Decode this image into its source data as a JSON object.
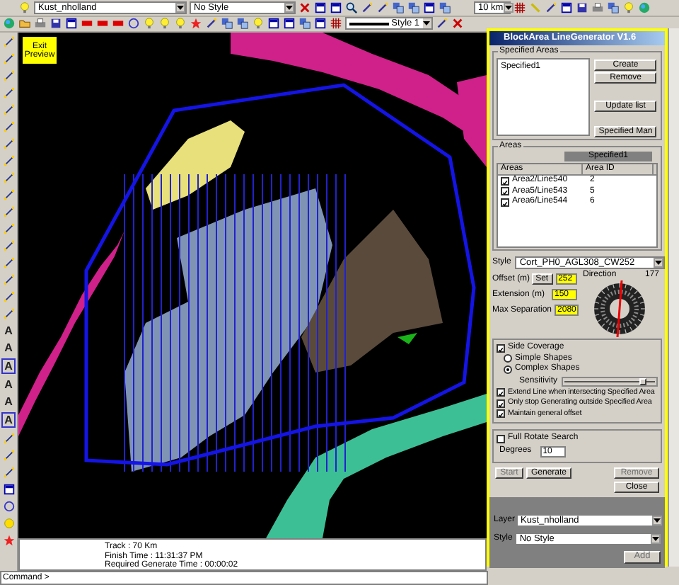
{
  "toolbar": {
    "layer_select": "Kust_nholland",
    "style_select": "No Style",
    "scale_select": "10 km",
    "line_style_select": "Style 1"
  },
  "tool_palette": {
    "text_tools": [
      "A",
      "A",
      "A",
      "A",
      "A",
      "A"
    ]
  },
  "map": {
    "exit_preview_button": "Exit Preview"
  },
  "output": {
    "lines": [
      "Track : 70 Km",
      "Finish Time : 11:31:37 PM",
      "Required Generate Time : 00:00:02"
    ],
    "command_prompt": "Command >"
  },
  "panel": {
    "title": "BlockArea LineGenerator V1.6",
    "specified_areas": {
      "label": "Specified Areas",
      "items": [
        {
          "label": "Specified1",
          "selected": false
        }
      ],
      "buttons": [
        "Create",
        "Remove",
        "Update list",
        "Specified Man"
      ]
    },
    "areas": {
      "label": "Areas",
      "set_name": "Specified1",
      "columns": [
        "Areas",
        "Area ID"
      ],
      "rows": [
        {
          "name": "Area2/Line540",
          "id": "2",
          "checked": true
        },
        {
          "name": "Area5/Line543",
          "id": "5",
          "checked": true
        },
        {
          "name": "Area6/Line544",
          "id": "6",
          "checked": true
        }
      ]
    },
    "style": {
      "label": "Style",
      "value": "Cort_PH0_AGL308_CW252"
    },
    "fields": [
      {
        "label": "Offset (m)",
        "button": "Set",
        "value": "252"
      },
      {
        "label": "Extension (m)",
        "value": "150"
      },
      {
        "label": "Max Separation",
        "value": "2080"
      }
    ],
    "direction": {
      "label": "Direction",
      "value": "177"
    },
    "side_coverage": {
      "label": "Side Coverage",
      "checked": true,
      "options": [
        {
          "label": "Simple Shapes",
          "selected": false
        },
        {
          "label": "Complex Shapes",
          "selected": true
        }
      ],
      "sensitivity": {
        "label": "Sensitivity",
        "level": 0.9
      }
    },
    "options": [
      {
        "label": "Extend Line when intersecting Specified Area",
        "checked": true
      },
      {
        "label": "Only stop Generating outside Specified Area",
        "checked": true
      },
      {
        "label": "Maintain general offset",
        "checked": true
      }
    ],
    "full_rotate": {
      "label": "Full Rotate Search",
      "checked": false,
      "degrees_label": "Degrees",
      "degrees": "10"
    },
    "actions": [
      {
        "label": "Start",
        "disabled": true
      },
      {
        "label": "Generate",
        "disabled": false
      },
      {
        "label": "Remove",
        "disabled": true
      },
      {
        "label": "Close",
        "disabled": false
      }
    ],
    "output_layer": {
      "layer_label": "Layer",
      "layer": "Kust_nholland",
      "style_label": "Style",
      "style": "No Style",
      "add": {
        "label": "Add",
        "disabled": true
      }
    }
  }
}
